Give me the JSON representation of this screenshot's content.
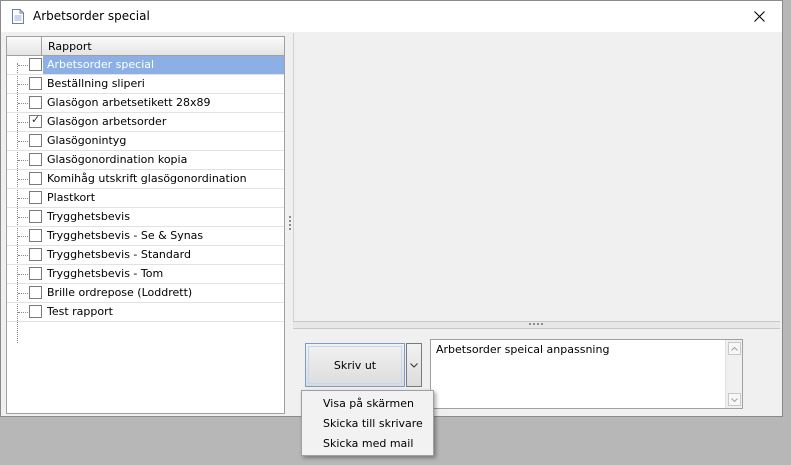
{
  "window": {
    "title": "Arbetsorder special",
    "close_glyph": "✕"
  },
  "report_list": {
    "header": "Rapport",
    "items": [
      {
        "label": "Arbetsorder special",
        "checked": false,
        "selected": true
      },
      {
        "label": "Beställning sliperi",
        "checked": false,
        "selected": false
      },
      {
        "label": "Glasögon arbetsetikett 28x89",
        "checked": false,
        "selected": false
      },
      {
        "label": "Glasögon arbetsorder",
        "checked": true,
        "selected": false
      },
      {
        "label": "Glasögonintyg",
        "checked": false,
        "selected": false
      },
      {
        "label": "Glasögonordination kopia",
        "checked": false,
        "selected": false
      },
      {
        "label": "Komihåg utskrift glasögonordination",
        "checked": false,
        "selected": false
      },
      {
        "label": "Plastkort",
        "checked": false,
        "selected": false
      },
      {
        "label": "Trygghetsbevis",
        "checked": false,
        "selected": false
      },
      {
        "label": "Trygghetsbevis - Se & Synas",
        "checked": false,
        "selected": false
      },
      {
        "label": "Trygghetsbevis - Standard",
        "checked": false,
        "selected": false
      },
      {
        "label": "Trygghetsbevis - Tom",
        "checked": false,
        "selected": false
      },
      {
        "label": "Brille ordrepose (Loddrett)",
        "checked": false,
        "selected": false
      },
      {
        "label": "Test rapport",
        "checked": false,
        "selected": false
      }
    ]
  },
  "print": {
    "label": "Skriv ut"
  },
  "description": {
    "text": "Arbetsorder speical anpassning"
  },
  "print_menu": {
    "items": [
      "Visa på skärmen",
      "Skicka till skrivare",
      "Skicka med mail"
    ]
  },
  "colors": {
    "selection": "#8cb0e6",
    "button_border": "#7a9cc6"
  }
}
